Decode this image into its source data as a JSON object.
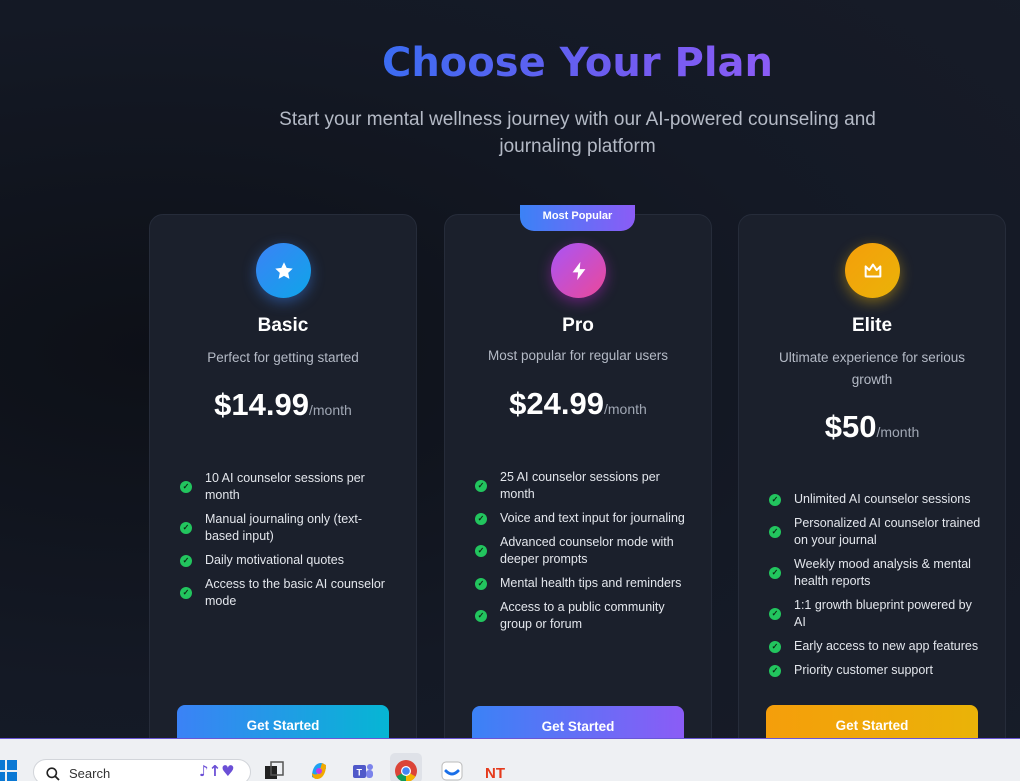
{
  "header": {
    "title": "Choose Your Plan",
    "subtitle": "Start your mental wellness journey with our AI-powered counseling and journaling platform"
  },
  "plans": [
    {
      "name": "Basic",
      "icon": "star-icon",
      "description": "Perfect for getting started",
      "price": "$14.99",
      "period": "/month",
      "features": [
        "10 AI counselor sessions per month",
        "Manual journaling only (text-based input)",
        "Daily motivational quotes",
        "Access to the basic AI counselor mode"
      ],
      "cta": "Get Started",
      "accent": "#3b82f6"
    },
    {
      "name": "Pro",
      "icon": "lightning-icon",
      "badge": "Most Popular",
      "description": "Most popular for regular users",
      "price": "$24.99",
      "period": "/month",
      "features": [
        "25 AI counselor sessions per month",
        "Voice and text input for journaling",
        "Advanced counselor mode with deeper prompts",
        "Mental health tips and reminders",
        "Access to a public community group or forum"
      ],
      "cta": "Get Started",
      "accent": "#a855f7"
    },
    {
      "name": "Elite",
      "icon": "crown-icon",
      "description": "Ultimate experience for serious growth",
      "price": "$50",
      "period": "/month",
      "features": [
        "Unlimited AI counselor sessions",
        "Personalized AI counselor trained on your journal",
        "Weekly mood analysis & mental health reports",
        "1:1 growth blueprint powered by AI",
        "Early access to new app features",
        "Priority customer support"
      ],
      "cta": "Get Started",
      "accent": "#f59e0b"
    }
  ],
  "taskbar": {
    "search_placeholder": "Search",
    "icons": [
      "windows-start-icon",
      "search-icon",
      "task-view-icon",
      "copilot-icon",
      "teams-icon",
      "chrome-icon",
      "app-icon",
      "nt-app-icon"
    ]
  },
  "colors": {
    "background": "#141925",
    "card": "#1b202c",
    "check": "#22c55e",
    "title_gradient_start": "#3b6cf2",
    "title_gradient_end": "#8b5cf6"
  }
}
